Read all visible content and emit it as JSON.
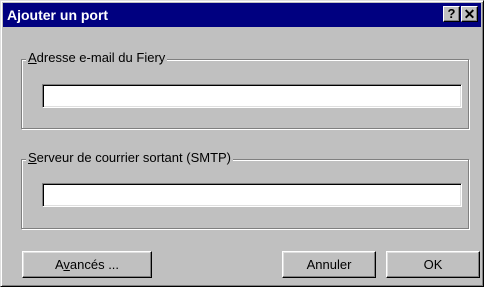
{
  "window": {
    "title": "Ajouter un port",
    "help_glyph": "?",
    "close_glyph": "✕"
  },
  "email_group": {
    "legend_first": "A",
    "legend_rest": "dresse e-mail du Fiery",
    "value": ""
  },
  "smtp_group": {
    "legend_first": "S",
    "legend_rest": "erveur de courrier sortant (SMTP)",
    "value": ""
  },
  "buttons": {
    "advanced_pre": "A",
    "advanced_mnemonic": "v",
    "advanced_post": "ancés ...",
    "cancel": "Annuler",
    "ok": "OK"
  },
  "icons": {
    "help": "help-icon",
    "close": "close-icon"
  },
  "colors": {
    "titlebar": "#000080",
    "face": "#c0c0c0"
  }
}
